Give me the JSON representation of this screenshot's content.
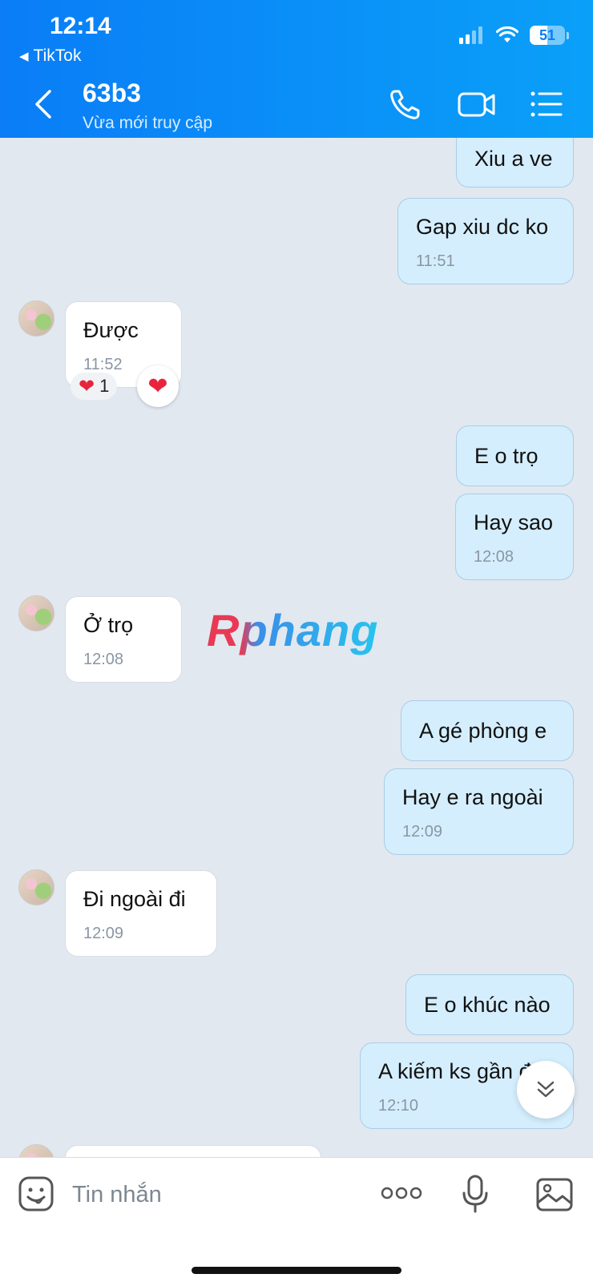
{
  "status_bar": {
    "time": "12:14",
    "back_app": "TikTok",
    "battery": "51",
    "battery_level": 0.51
  },
  "header": {
    "title": "63b3",
    "subtitle": "Vừa mới truy cập"
  },
  "messages": [
    {
      "side": "me",
      "text": "Xiu a ve",
      "time": ""
    },
    {
      "side": "me",
      "text": "Gap xiu dc ko",
      "time": "11:51"
    },
    {
      "side": "them",
      "text": "Được",
      "time": "11:52",
      "reaction_count": "1"
    },
    {
      "side": "me",
      "text": "E o trọ",
      "time": ""
    },
    {
      "side": "me",
      "text": "Hay sao",
      "time": "12:08"
    },
    {
      "side": "them",
      "text": "Ở trọ",
      "time": "12:08"
    },
    {
      "side": "me",
      "text": "A gé phòng e",
      "time": ""
    },
    {
      "side": "me",
      "text": "Hay e ra ngoài",
      "time": "12:09"
    },
    {
      "side": "them",
      "text": "Đi ngoài đi",
      "time": "12:09"
    },
    {
      "side": "me",
      "text": "E o khúc nào",
      "time": ""
    },
    {
      "side": "me",
      "text": "A kiếm ks gần đó",
      "time": "12:10"
    }
  ],
  "watermark": "Rphang",
  "input": {
    "placeholder": "Tin nhắn"
  },
  "icons": [
    "back-icon",
    "phone-icon",
    "video-icon",
    "menu-icon",
    "sticker-icon",
    "more-icon",
    "microphone-icon",
    "image-icon",
    "chevron-double-down-icon",
    "heart-icon"
  ],
  "colors": {
    "header": "#0a7df7",
    "my_bubble": "#d4eefd",
    "their_bubble": "#ffffff",
    "background": "#e2e8f0",
    "heart": "#e8243c"
  }
}
